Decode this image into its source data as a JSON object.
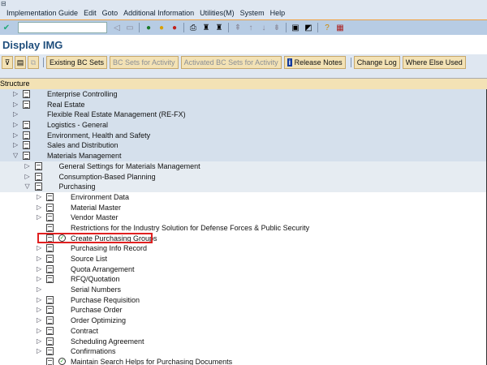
{
  "menu": [
    "Implementation Guide",
    "Edit",
    "Goto",
    "Additional Information",
    "Utilities(M)",
    "System",
    "Help"
  ],
  "title": "Display IMG",
  "buttons": {
    "existing": "Existing BC Sets",
    "bc_activity": "BC Sets for Activity",
    "activated": "Activated BC Sets for Activity",
    "release": "Release Notes",
    "change_log": "Change Log",
    "where_used": "Where Else Used"
  },
  "structure_label": "Structure",
  "tree": [
    {
      "label": "Enterprise Controlling",
      "level": 0,
      "state": "collapsed",
      "doc": true
    },
    {
      "label": "Real Estate",
      "level": 0,
      "state": "collapsed",
      "doc": true
    },
    {
      "label": "Flexible Real Estate Management (RE-FX)",
      "level": 0,
      "state": "collapsed",
      "doc": false
    },
    {
      "label": "Logistics - General",
      "level": 0,
      "state": "collapsed",
      "doc": true
    },
    {
      "label": "Environment, Health and Safety",
      "level": 0,
      "state": "collapsed",
      "doc": true
    },
    {
      "label": "Sales and Distribution",
      "level": 0,
      "state": "collapsed",
      "doc": true
    },
    {
      "label": "Materials Management",
      "level": 0,
      "state": "expanded",
      "doc": true
    },
    {
      "label": "General Settings for Materials Management",
      "level": 1,
      "state": "collapsed",
      "doc": true
    },
    {
      "label": "Consumption-Based Planning",
      "level": 1,
      "state": "collapsed",
      "doc": true
    },
    {
      "label": "Purchasing",
      "level": 1,
      "state": "expanded",
      "doc": true
    },
    {
      "label": "Environment Data",
      "level": 2,
      "state": "collapsed",
      "doc": true
    },
    {
      "label": "Material Master",
      "level": 2,
      "state": "collapsed",
      "doc": true
    },
    {
      "label": "Vendor Master",
      "level": 2,
      "state": "collapsed",
      "doc": true
    },
    {
      "label": "Restrictions for the Industry Solution for Defense Forces & Public Security",
      "level": 2,
      "state": "leaf",
      "doc": true
    },
    {
      "label": "Create Purchasing Groups",
      "level": 2,
      "state": "leaf",
      "doc": true,
      "activity": true
    },
    {
      "label": "Purchasing Info Record",
      "level": 2,
      "state": "collapsed",
      "doc": true
    },
    {
      "label": "Source List",
      "level": 2,
      "state": "collapsed",
      "doc": true
    },
    {
      "label": "Quota Arrangement",
      "level": 2,
      "state": "collapsed",
      "doc": true
    },
    {
      "label": "RFQ/Quotation",
      "level": 2,
      "state": "collapsed",
      "doc": true
    },
    {
      "label": "Serial Numbers",
      "level": 2,
      "state": "collapsed",
      "doc": false
    },
    {
      "label": "Purchase Requisition",
      "level": 2,
      "state": "collapsed",
      "doc": true
    },
    {
      "label": "Purchase Order",
      "level": 2,
      "state": "collapsed",
      "doc": true
    },
    {
      "label": "Order Optimizing",
      "level": 2,
      "state": "collapsed",
      "doc": true
    },
    {
      "label": "Contract",
      "level": 2,
      "state": "collapsed",
      "doc": true
    },
    {
      "label": "Scheduling Agreement",
      "level": 2,
      "state": "collapsed",
      "doc": true
    },
    {
      "label": "Confirmations",
      "level": 2,
      "state": "collapsed",
      "doc": true
    },
    {
      "label": "Maintain Search Helps for Purchasing Documents",
      "level": 2,
      "state": "leaf",
      "doc": true,
      "activity": true
    }
  ]
}
